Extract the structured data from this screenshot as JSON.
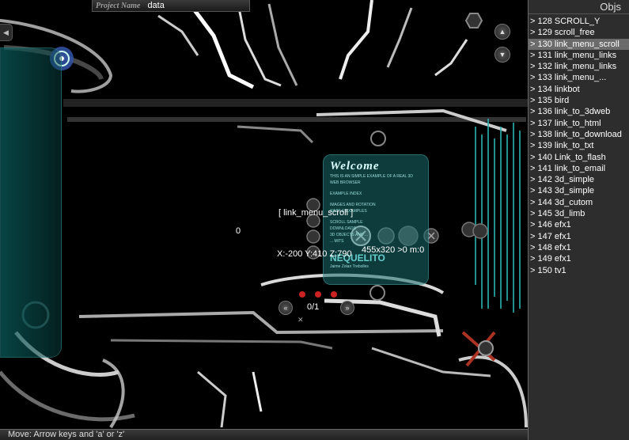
{
  "project": {
    "label": "Project Name",
    "value": "data"
  },
  "objs": {
    "title": "Objs",
    "selected_index": 2,
    "items": [
      "> 128 SCROLL_Y",
      "> 129 scroll_free",
      "> 130 link_menu_scroll",
      "> 131 link_menu_links",
      "> 132 link_menu_links",
      "> 133 link_menu_...",
      "> 134 linkbot",
      "> 135 bird",
      "> 136 link_to_3dweb",
      "> 137 link_to_html",
      "> 138 link_to_download",
      "> 139 link_to_txt",
      "> 140 Link_to_flash",
      "> 141 link_to_email",
      "> 142 3d_simple",
      "> 143 3d_simple",
      "> 144 3d_cutom",
      "> 145 3d_limb",
      "> 146 efx1",
      "> 147 efx1",
      "> 148 efx1",
      "> 149 efx1",
      "> 150 tv1"
    ]
  },
  "viewport": {
    "hover_object": "[ link_menu_scroll ]",
    "counter": "0",
    "coords": "X:-200 Y:410 Z:790",
    "size_info": "455x320 >0 m:0",
    "page_counter": "0/1"
  },
  "welcome_panel": {
    "title": "Welcome",
    "lines": [
      "THIS IS AN SIMPLE EXAMPLE OF A REAL 3D",
      "WEB BROWSER",
      "",
      "EXAMPLE INDEX",
      "",
      "IMAGES AND ROTATION",
      "SIMPLE EXAMPLES",
      "",
      "SCROLL SAMPLE",
      "DOWNLOADS",
      "3D OBJECTS AND ...",
      "... MITS"
    ],
    "signature": "NEQUELITO",
    "signature_sub": "Jaime Zolan Trebolles"
  },
  "nav_buttons": {
    "left_arrow": "◀",
    "up": "▲",
    "down": "▼",
    "prev": "«",
    "next": "»",
    "close": "✕"
  },
  "status": {
    "text": "Move: Arrow keys and 'a' or 'z'"
  },
  "colors": {
    "panel_bg": "#373737",
    "selected_row": "#6b6b6b",
    "teal": "#1a6e6e",
    "accent": "#5577cc"
  }
}
